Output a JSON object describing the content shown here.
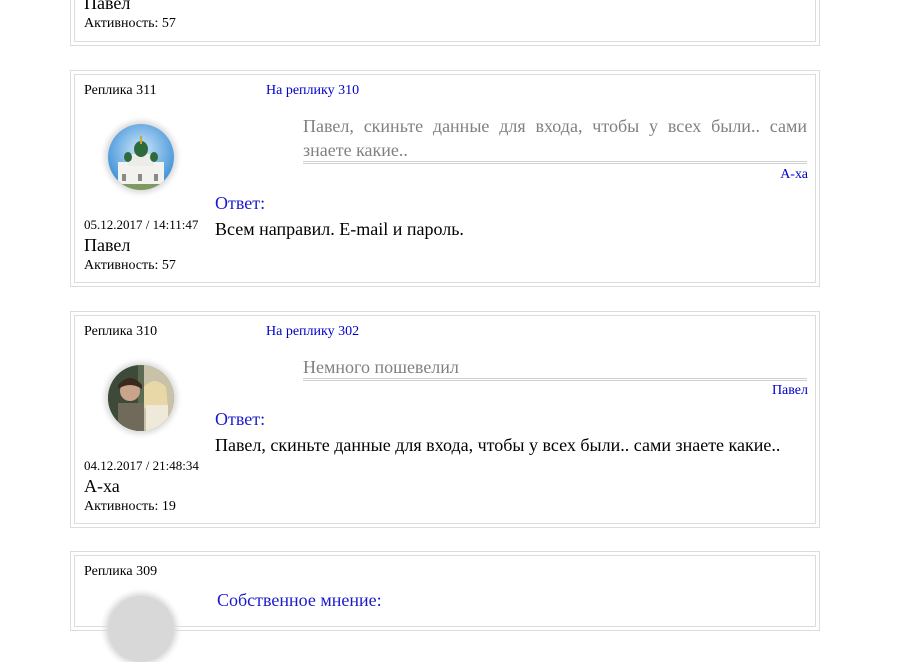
{
  "comments": [
    {
      "author": "Павел",
      "activity": "Активность: 57"
    },
    {
      "reply_label": "Реплика 311",
      "reply_to": "На реплику 310",
      "quote_text": "Павел, скиньте данные для входа, чтобы у всех были.. сами знаете какие..",
      "quote_author": "А-ха",
      "answer_label": "Ответ:",
      "answer_text": "Всем направил. E-mail и пароль.",
      "date": "05.12.2017 / 14:11:47",
      "author": "Павел",
      "activity": "Активность: 57"
    },
    {
      "reply_label": "Реплика 310",
      "reply_to": "На реплику 302",
      "quote_text": "Немного пошевелил",
      "quote_author": "Павел",
      "answer_label": "Ответ:",
      "answer_text": "Павел, скиньте данные для входа, чтобы у всех были.. сами знаете какие..",
      "date": "04.12.2017 / 21:48:34",
      "author": "А-ха",
      "activity": "Активность: 19"
    },
    {
      "reply_label": "Реплика 309",
      "answer_label": "Собственное мнение:"
    }
  ]
}
